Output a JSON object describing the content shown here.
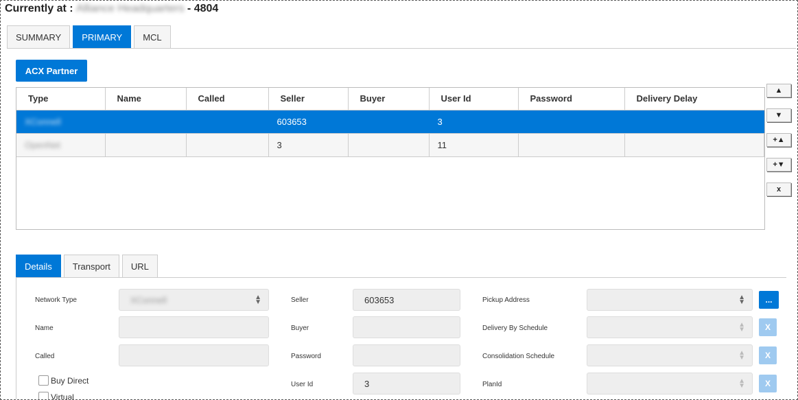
{
  "header": {
    "prefix": "Currently at :",
    "location": "Alliance Headquarters",
    "separator": "-",
    "code": "4804"
  },
  "top_tabs": [
    {
      "label": "SUMMARY"
    },
    {
      "label": "PRIMARY"
    },
    {
      "label": "MCL"
    }
  ],
  "acx_button": "ACX Partner",
  "grid": {
    "columns": [
      "Type",
      "Name",
      "Called",
      "Seller",
      "Buyer",
      "User Id",
      "Password",
      "Delivery Delay"
    ],
    "rows": [
      {
        "type": "XConnell",
        "name": "",
        "called": "",
        "seller": "603653",
        "buyer": "",
        "user_id": "3",
        "password": "",
        "delivery_delay": ""
      },
      {
        "type": "OpenNet",
        "name": "",
        "called": "",
        "seller": "3",
        "buyer": "",
        "user_id": "11",
        "password": "",
        "delivery_delay": ""
      }
    ]
  },
  "side_buttons": {
    "up": "▲",
    "down": "▼",
    "add_up": "+▲",
    "add_down": "+▼",
    "delete": "x"
  },
  "detail_tabs": [
    {
      "label": "Details"
    },
    {
      "label": "Transport"
    },
    {
      "label": "URL"
    }
  ],
  "details": {
    "network_type_label": "Network Type",
    "network_type_value": "XConnell",
    "name_label": "Name",
    "name_value": "",
    "called_label": "Called",
    "called_value": "",
    "buy_direct_label": "Buy Direct",
    "virtual_label": "Virtual",
    "seller_label": "Seller",
    "seller_value": "603653",
    "buyer_label": "Buyer",
    "buyer_value": "",
    "password_label": "Password",
    "password_value": "",
    "user_id_label": "User Id",
    "user_id_value": "3",
    "pickup_label": "Pickup Address",
    "delivery_sched_label": "Delivery By Schedule",
    "consolidation_label": "Consolidation Schedule",
    "plan_label": "PlanId",
    "ellipsis": "...",
    "clear": "X"
  },
  "colors": {
    "accent": "#0078d7",
    "disabled_button": "#9fcaf0"
  }
}
